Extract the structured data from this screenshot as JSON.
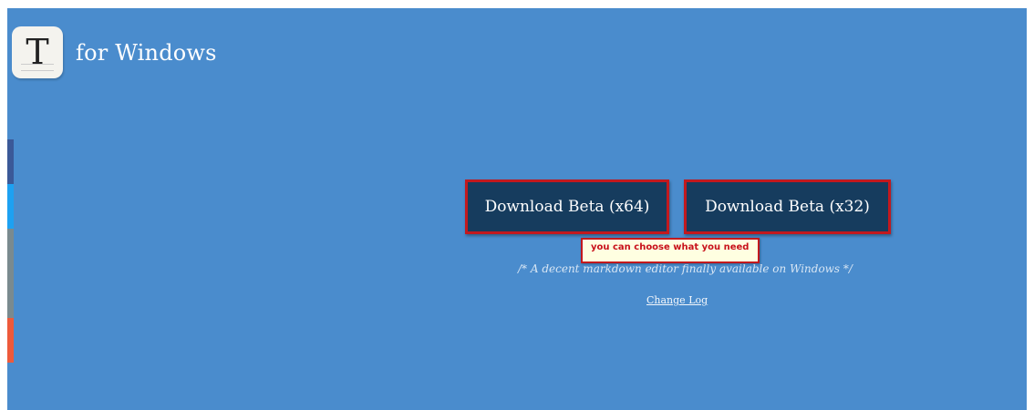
{
  "header": {
    "logo_letter": "T",
    "title": "for Windows"
  },
  "share_bar": {
    "colors": [
      "#3b5998",
      "#1da1f2",
      "#7a8a8f",
      "#7a8a8f",
      "#ee5a3b"
    ]
  },
  "downloads": {
    "x64_label": "Download Beta (x64)",
    "x32_label": "Download Beta (x32)"
  },
  "tooltip": {
    "text": "you can choose what you need"
  },
  "tagline": "/* A decent markdown editor finally available on Windows */",
  "changelog_label": "Change Log",
  "colors": {
    "background": "#4a8ccd",
    "button": "#163c5e",
    "highlight": "#c2191e",
    "tooltip_bg": "#ffffe1"
  }
}
